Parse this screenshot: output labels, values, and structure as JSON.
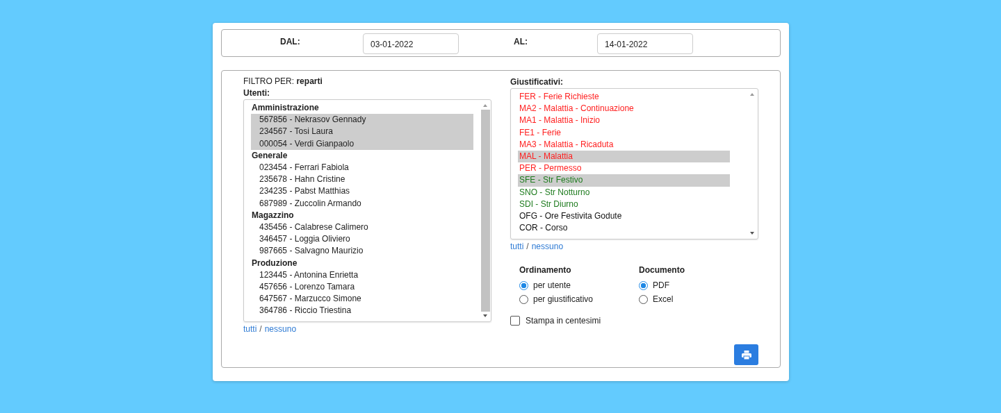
{
  "period": {
    "from_label": "DAL:",
    "from_value": "03-01-2022",
    "to_label": "AL:",
    "to_value": "14-01-2022"
  },
  "filter": {
    "text": "FILTRO PER: **reparti**"
  },
  "users": {
    "label": "Utenti:",
    "groups": [
      {
        "name": "Amministrazione",
        "items": [
          {
            "label": "567856 - Nekrasov Gennady",
            "selected": true
          },
          {
            "label": "234567 - Tosi Laura",
            "selected": true
          },
          {
            "label": "000054 - Verdi Gianpaolo",
            "selected": true
          }
        ]
      },
      {
        "name": "Generale",
        "items": [
          {
            "label": "023454 - Ferrari Fabiola",
            "selected": false
          },
          {
            "label": "235678 - Hahn Cristine",
            "selected": false
          },
          {
            "label": "234235 - Pabst Matthias",
            "selected": false
          },
          {
            "label": "687989 - Zuccolin Armando",
            "selected": false
          }
        ]
      },
      {
        "name": "Magazzino",
        "items": [
          {
            "label": "435456 - Calabrese Calimero",
            "selected": false
          },
          {
            "label": "346457 - Loggia Oliviero",
            "selected": false
          },
          {
            "label": "987665 - Salvagno Maurizio",
            "selected": false
          }
        ]
      },
      {
        "name": "Produzione",
        "items": [
          {
            "label": "123445 - Antonina Enrietta",
            "selected": false
          },
          {
            "label": "457656 - Lorenzo Tamara",
            "selected": false
          },
          {
            "label": "647567 - Marzucco Simone",
            "selected": false
          },
          {
            "label": "364786 - Riccio Triestina",
            "selected": false
          }
        ]
      }
    ],
    "all_link": "tutti",
    "separator": "/",
    "none_link": "nessuno"
  },
  "justifications": {
    "label": "Giustificativi:",
    "items": [
      {
        "label": "FER - Ferie Richieste",
        "color": "#ff2020",
        "selected": false
      },
      {
        "label": "MA2 - Malattia - Continuazione",
        "color": "#ff2020",
        "selected": false
      },
      {
        "label": "MA1 - Malattia - Inizio",
        "color": "#ff2020",
        "selected": false
      },
      {
        "label": "FE1 - Ferie",
        "color": "#ff2020",
        "selected": false
      },
      {
        "label": "MA3 - Malattia - Ricaduta",
        "color": "#ff2020",
        "selected": false
      },
      {
        "label": "MAL - Malattia",
        "color": "#ff2020",
        "selected": true
      },
      {
        "label": "PER - Permesso",
        "color": "#ff2020",
        "selected": false
      },
      {
        "label": "SFE - Str Festivo",
        "color": "#1e7b1e",
        "selected": true
      },
      {
        "label": "SNO - Str Notturno",
        "color": "#1e7b1e",
        "selected": false
      },
      {
        "label": "SDI - Str Diurno",
        "color": "#1e7b1e",
        "selected": false
      },
      {
        "label": "OFG - Ore Festivita Godute",
        "color": "#111111",
        "selected": false
      },
      {
        "label": "COR - Corso",
        "color": "#111111",
        "selected": false
      }
    ],
    "all_link": "tutti",
    "separator": "/",
    "none_link": "nessuno"
  },
  "ordering": {
    "title": "Ordinamento",
    "options": [
      {
        "label": "per utente",
        "selected": true
      },
      {
        "label": "per giustificativo",
        "selected": false
      }
    ]
  },
  "document": {
    "title": "Documento",
    "options": [
      {
        "label": "PDF",
        "selected": true
      },
      {
        "label": "Excel",
        "selected": false
      }
    ]
  },
  "cents": {
    "label": "Stampa in centesimi",
    "checked": false
  }
}
